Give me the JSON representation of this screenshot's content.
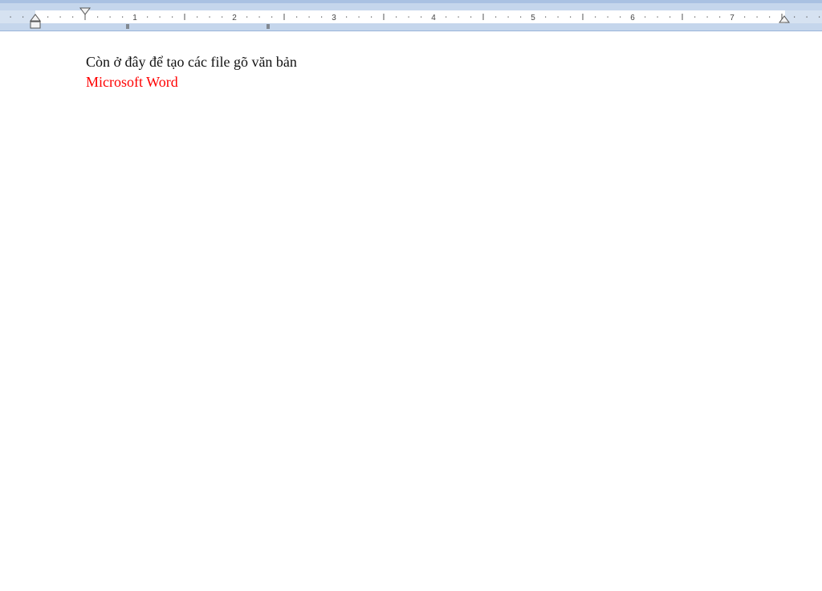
{
  "ruler": {
    "numbers": [
      "1",
      "2",
      "3",
      "4",
      "5",
      "6",
      "7"
    ]
  },
  "document": {
    "line1": "Còn ở đây để tạo các file gõ văn bản",
    "line2": "Microsoft Word",
    "line2_color": "#ff0000"
  }
}
